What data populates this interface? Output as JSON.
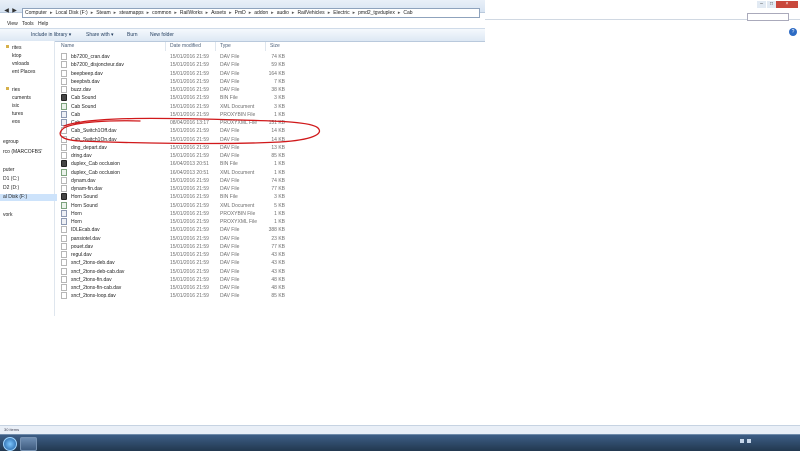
{
  "window": {
    "close_label": "×",
    "min_label": "–",
    "max_label": "□"
  },
  "address": {
    "crumbs": [
      "Computer",
      "Local Disk (F:)",
      "Steam",
      "steamapps",
      "common",
      "RailWorks",
      "Assets",
      "PmD",
      "addon",
      "audio",
      "RailVehicles",
      "Electric",
      "pmd2_tgvduplex",
      "Cab"
    ]
  },
  "menu": [
    "View",
    "Tools",
    "Help"
  ],
  "toolbar": {
    "include": "Include in library ▾",
    "share": "Share with ▾",
    "burn": "Burn",
    "new_folder": "New folder"
  },
  "columns": {
    "name": "Name",
    "date": "Date modified",
    "type": "Type",
    "size": "Size"
  },
  "nav": [
    "rites",
    "ktop",
    "vnloads",
    "ent Places",
    "ries",
    "cuments",
    "isic",
    "tures",
    "eos",
    "egroup",
    "rco (MARCOFBS'",
    "puter",
    "D1 (C:)",
    "D2 (D:)",
    "al Disk (F:)",
    "vork"
  ],
  "files": [
    {
      "name": "bb7200_cran.dav",
      "date": "15/01/2016 21:59",
      "type": "DAV File",
      "size": "74 KB",
      "icon": "dav"
    },
    {
      "name": "bb7200_disjoncteur.dav",
      "date": "15/01/2016 21:59",
      "type": "DAV File",
      "size": "59 KB",
      "icon": "dav"
    },
    {
      "name": "beepbeep.dav",
      "date": "15/01/2016 21:59",
      "type": "DAV File",
      "size": "164 KB",
      "icon": "dav"
    },
    {
      "name": "beepbvb.dav",
      "date": "15/01/2016 21:59",
      "type": "DAV File",
      "size": "7 KB",
      "icon": "dav"
    },
    {
      "name": "buzz.dav",
      "date": "15/01/2016 21:59",
      "type": "DAV File",
      "size": "38 KB",
      "icon": "dav"
    },
    {
      "name": "Cab Sound",
      "date": "15/01/2016 21:59",
      "type": "BIN File",
      "size": "3 KB",
      "icon": "bin"
    },
    {
      "name": "Cab Sound",
      "date": "15/01/2016 21:59",
      "type": "XML Document",
      "size": "3 KB",
      "icon": "xml"
    },
    {
      "name": "Cab",
      "date": "15/01/2016 21:59",
      "type": "PROXYBIN File",
      "size": "1 KB",
      "icon": "prx"
    },
    {
      "name": "Cab",
      "date": "08/04/2016 13:17",
      "type": "PROXYXML File",
      "size": "151 KB",
      "icon": "prx"
    },
    {
      "name": "Cab_Switch1Off.dav",
      "date": "15/01/2016 21:59",
      "type": "DAV File",
      "size": "14 KB",
      "icon": "dav"
    },
    {
      "name": "Cab_Switch1On.dav",
      "date": "15/01/2016 21:59",
      "type": "DAV File",
      "size": "14 KB",
      "icon": "dav"
    },
    {
      "name": "ding_depart.dav",
      "date": "15/01/2016 21:59",
      "type": "DAV File",
      "size": "13 KB",
      "icon": "dav"
    },
    {
      "name": "dring.dav",
      "date": "15/01/2016 21:59",
      "type": "DAV File",
      "size": "85 KB",
      "icon": "dav"
    },
    {
      "name": "duplex_Cab occlusion",
      "date": "16/04/2013 20:51",
      "type": "BIN File",
      "size": "1 KB",
      "icon": "bin"
    },
    {
      "name": "duplex_Cab occlusion",
      "date": "16/04/2013 20:51",
      "type": "XML Document",
      "size": "1 KB",
      "icon": "xml"
    },
    {
      "name": "dynam.dav",
      "date": "15/01/2016 21:59",
      "type": "DAV File",
      "size": "74 KB",
      "icon": "dav"
    },
    {
      "name": "dynam-fin.dav",
      "date": "15/01/2016 21:59",
      "type": "DAV File",
      "size": "77 KB",
      "icon": "dav"
    },
    {
      "name": "Horn Sound",
      "date": "15/01/2016 21:59",
      "type": "BIN File",
      "size": "3 KB",
      "icon": "bin"
    },
    {
      "name": "Horn Sound",
      "date": "15/01/2016 21:59",
      "type": "XML Document",
      "size": "5 KB",
      "icon": "xml"
    },
    {
      "name": "Horn",
      "date": "15/01/2016 21:59",
      "type": "PROXYBIN File",
      "size": "1 KB",
      "icon": "prx"
    },
    {
      "name": "Horn",
      "date": "15/01/2016 21:59",
      "type": "PROXYXML File",
      "size": "1 KB",
      "icon": "prx"
    },
    {
      "name": "IDLEcab.dav",
      "date": "15/01/2016 21:59",
      "type": "DAV File",
      "size": "388 KB",
      "icon": "dav"
    },
    {
      "name": "pansiotel.dav",
      "date": "15/01/2016 21:59",
      "type": "DAV File",
      "size": "23 KB",
      "icon": "dav"
    },
    {
      "name": "pouet.dav",
      "date": "15/01/2016 21:59",
      "type": "DAV File",
      "size": "77 KB",
      "icon": "dav"
    },
    {
      "name": "regul.dav",
      "date": "15/01/2016 21:59",
      "type": "DAV File",
      "size": "43 KB",
      "icon": "dav"
    },
    {
      "name": "sncf_2tons-deb.dav",
      "date": "15/01/2016 21:59",
      "type": "DAV File",
      "size": "43 KB",
      "icon": "dav"
    },
    {
      "name": "sncf_2tons-deb-cab.dav",
      "date": "15/01/2016 21:59",
      "type": "DAV File",
      "size": "43 KB",
      "icon": "dav"
    },
    {
      "name": "sncf_2tons-fin.dav",
      "date": "15/01/2016 21:59",
      "type": "DAV File",
      "size": "48 KB",
      "icon": "dav"
    },
    {
      "name": "sncf_2tons-fin-cab.dav",
      "date": "15/01/2016 21:59",
      "type": "DAV File",
      "size": "48 KB",
      "icon": "dav"
    },
    {
      "name": "sncf_2tons-loop.dav",
      "date": "15/01/2016 21:59",
      "type": "DAV File",
      "size": "85 KB",
      "icon": "dav"
    }
  ],
  "status": {
    "text": "30 items"
  },
  "annotation_color": "#d0191b"
}
